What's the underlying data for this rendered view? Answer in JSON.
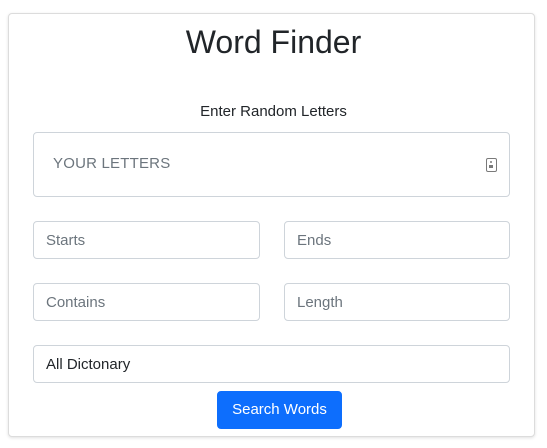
{
  "header": {
    "title": "Word Finder"
  },
  "form": {
    "letters_label": "Enter Random Letters",
    "letters_placeholder": "YOUR LETTERS",
    "letters_icon": "contact-card-icon",
    "starts_placeholder": "Starts",
    "ends_placeholder": "Ends",
    "contains_placeholder": "Contains",
    "length_placeholder": "Length",
    "dictionary_selected": "All Dictonary",
    "search_label": "Search Words"
  },
  "colors": {
    "button_bg": "#0d6efd",
    "button_text": "#ffffff",
    "border": "#ced4da",
    "placeholder": "#6c757d"
  }
}
